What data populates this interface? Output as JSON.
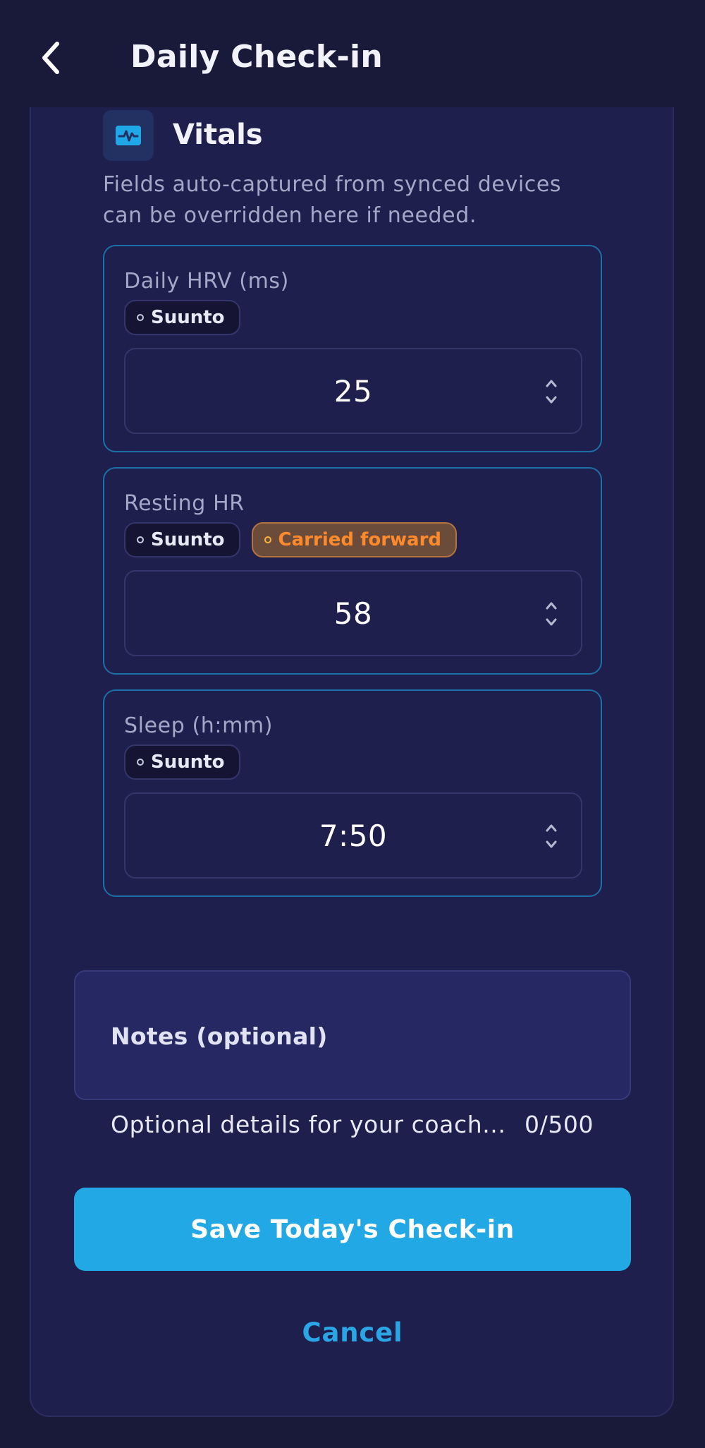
{
  "header": {
    "title": "Daily Check-in"
  },
  "section": {
    "title": "Vitals",
    "description_line1": "Fields auto-captured from synced devices",
    "description_line2": "can be overridden here if needed."
  },
  "fields": [
    {
      "label": "Daily HRV (ms)",
      "source": "Suunto",
      "value": "25"
    },
    {
      "label": "Resting HR",
      "source": "Suunto",
      "status": "Carried forward",
      "value": "58"
    },
    {
      "label": "Sleep (h:mm)",
      "source": "Suunto",
      "value": "7:50"
    }
  ],
  "notes": {
    "label": "Notes (optional)",
    "placeholder": "Optional details for your coach...",
    "counter": "0/500"
  },
  "actions": {
    "save_label": "Save Today's Check-in",
    "cancel_label": "Cancel"
  },
  "colors": {
    "background": "#191939",
    "card": "#1f1f4d",
    "accent": "#21a8e5",
    "field_border": "#1c6fa7",
    "carried_forward": "#ff8a2c"
  }
}
